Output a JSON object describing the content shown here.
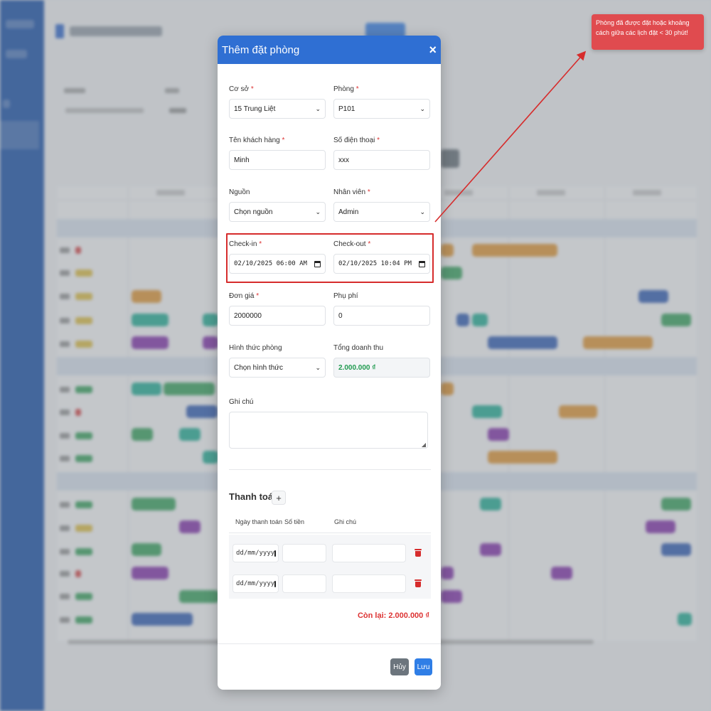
{
  "modal": {
    "title": "Thêm đặt phòng",
    "close_label": "×",
    "fields": {
      "co_so": {
        "label": "Cơ sở",
        "value": "15 Trung Liệt"
      },
      "phong": {
        "label": "Phòng",
        "value": "P101"
      },
      "ten_khach_hang": {
        "label": "Tên khách hàng",
        "value": "Minh"
      },
      "so_dien_thoai": {
        "label": "Số điện thoại",
        "value": "xxx"
      },
      "nguon": {
        "label": "Nguồn",
        "value": "Chọn nguồn"
      },
      "nhan_vien": {
        "label": "Nhân viên",
        "value": "Admin"
      },
      "check_in": {
        "label": "Check-in",
        "value": "02/10/2025 06:00 AM"
      },
      "check_out": {
        "label": "Check-out",
        "value": "02/10/2025 10:04 PM"
      },
      "don_gia": {
        "label": "Đơn giá",
        "value": "2000000"
      },
      "phu_phi": {
        "label": "Phụ phí",
        "value": "0"
      },
      "hinh_thuc_phong": {
        "label": "Hình thức phòng",
        "value": "Chọn hình thức"
      },
      "tong_doanh_thu": {
        "label": "Tổng doanh thu",
        "value": "2.000.000 ₫"
      },
      "ghi_chu": {
        "label": "Ghi chú",
        "value": ""
      }
    },
    "required_mark": "*",
    "payment": {
      "title": "Thanh toán",
      "add_label": "+",
      "columns": [
        "Ngày thanh toán",
        "Số tiền",
        "Ghi chú"
      ],
      "rows": [
        {
          "date_placeholder": "dd/mm/yyyy",
          "amount": "",
          "note": ""
        },
        {
          "date_placeholder": "dd/mm/yyyy",
          "amount": "",
          "note": ""
        }
      ],
      "remaining": "Còn lại: 2.000.000 ₫"
    },
    "buttons": {
      "cancel": "Hủy",
      "save": "Lưu"
    }
  },
  "toast": {
    "message": "Phòng đã được đặt hoặc khoảng cách giữa các lịch đặt < 30 phút!",
    "color": "#e04b4f"
  },
  "colors": {
    "primary": "#2f6fd3",
    "danger": "#d62c2c",
    "success": "#1f9a4f"
  }
}
